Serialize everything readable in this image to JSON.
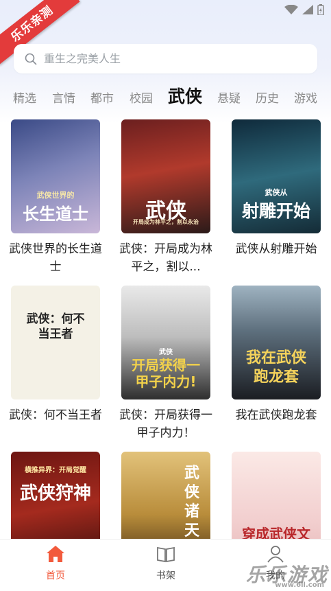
{
  "ribbon": {
    "text": "乐乐亲测"
  },
  "search": {
    "placeholder": "重生之完美人生"
  },
  "tabs": [
    {
      "label": "精选"
    },
    {
      "label": "言情"
    },
    {
      "label": "都市"
    },
    {
      "label": "校园"
    },
    {
      "label": "武侠"
    },
    {
      "label": "悬疑"
    },
    {
      "label": "历史"
    },
    {
      "label": "游戏"
    }
  ],
  "active_tab": "武侠",
  "books": [
    {
      "title": "武侠世界的长生道士",
      "cover_text": "长生道士",
      "cover_sub": "武侠世界的"
    },
    {
      "title": "武侠：开局成为林平之，割以...",
      "cover_text": "武侠",
      "cover_sub": "开局成为林平之，割以永治"
    },
    {
      "title": "武侠从射雕开始",
      "cover_text": "射雕开始",
      "cover_sub": "武侠从"
    },
    {
      "title": "武侠：何不当王者",
      "cover_text": "武侠：何不当王者",
      "cover_sub": ""
    },
    {
      "title": "武侠：开局获得一甲子内力！",
      "cover_text": "开局获得一甲子内力!",
      "cover_sub": "武侠"
    },
    {
      "title": "我在武侠跑龙套",
      "cover_text": "我在武侠跑龙套",
      "cover_sub": ""
    },
    {
      "title": "",
      "cover_text": "武侠狩神",
      "cover_sub": "横推异界：开局觉醒"
    },
    {
      "title": "",
      "cover_text": "武侠诸天",
      "cover_sub": ""
    },
    {
      "title": "",
      "cover_text": "穿成武侠文",
      "cover_sub": ""
    }
  ],
  "nav": [
    {
      "label": "首页",
      "icon": "home-icon",
      "active": true
    },
    {
      "label": "书架",
      "icon": "book-icon",
      "active": false
    },
    {
      "label": "我的",
      "icon": "user-icon",
      "active": false
    }
  ],
  "colors": {
    "accent": "#f25a3c",
    "ribbon": "#e33b3b"
  },
  "watermark": {
    "text": "乐乐游戏",
    "sub": "www.6ll.com"
  }
}
